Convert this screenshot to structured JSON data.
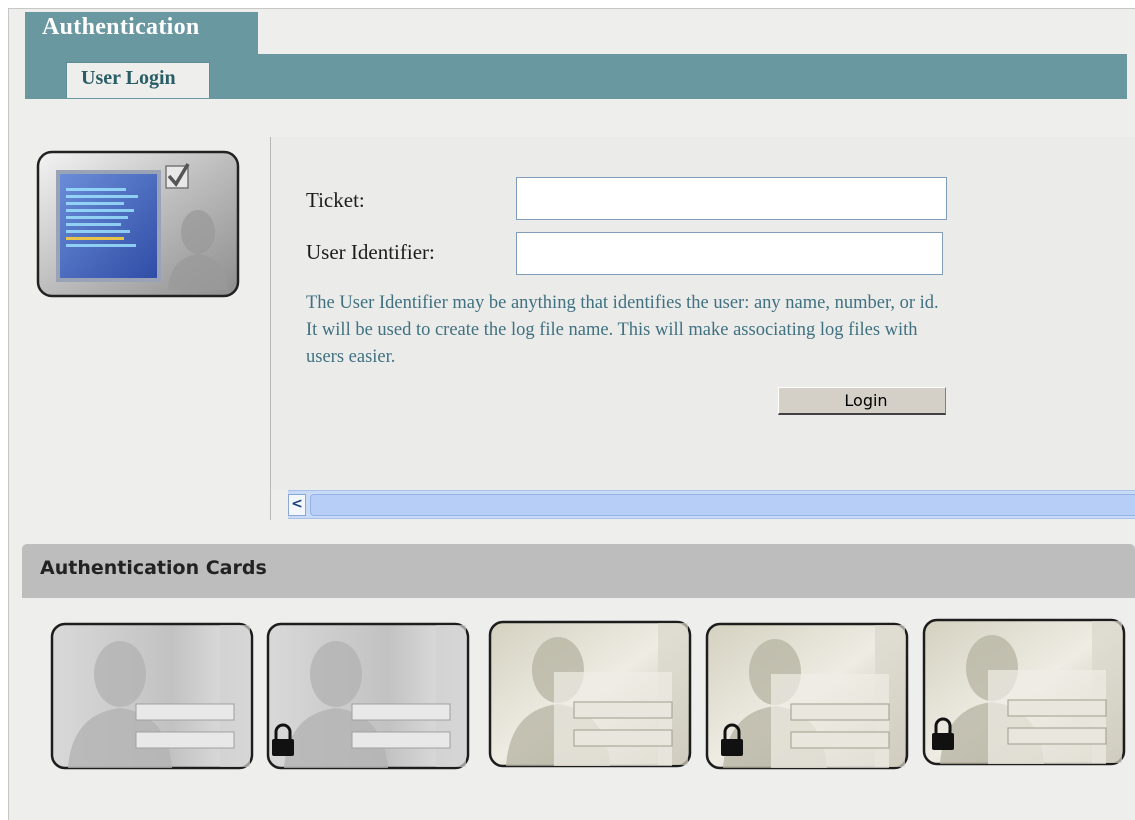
{
  "tabs": {
    "outer": "Authentication",
    "inner": "User Login"
  },
  "form": {
    "ticket_label": "Ticket:",
    "ticket_value": "",
    "user_identifier_label": "User Identifier:",
    "user_identifier_value": "",
    "help_text": "The User Identifier may be anything that identifies the user: any name, number, or id. It will be used to create the log file name. This will make associating log files with users easier.",
    "login_label": "Login"
  },
  "scrollbar": {
    "left_arrow": "<"
  },
  "cards_section": {
    "title": "Authentication Cards",
    "cards": [
      {
        "style": "silver",
        "locked": false
      },
      {
        "style": "silver",
        "locked": true
      },
      {
        "style": "beige",
        "locked": false
      },
      {
        "style": "beige",
        "locked": true
      },
      {
        "style": "beige",
        "locked": true
      }
    ]
  },
  "colors": {
    "tab_band": "#6a98a1",
    "help_text": "#3f7180",
    "scroll_track": "#c9daf7"
  }
}
